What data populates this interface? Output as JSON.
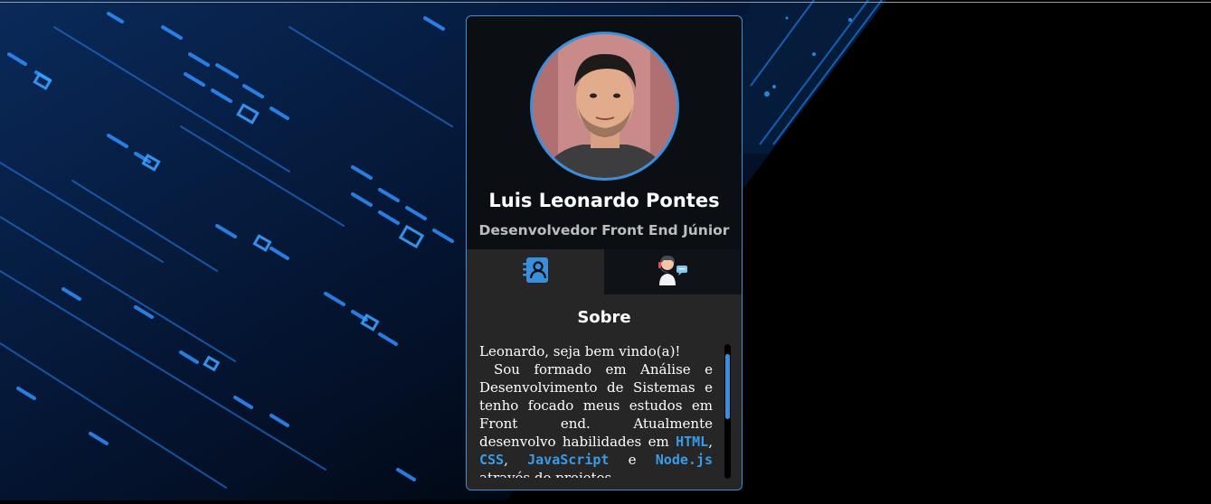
{
  "profile": {
    "name": "Luis Leonardo Pontes",
    "role": "Desenvolvedor Front End Júnior"
  },
  "tabs": [
    {
      "icon": "contact-book-icon",
      "active": true
    },
    {
      "icon": "support-agent-icon",
      "active": false
    }
  ],
  "about": {
    "title": "Sobre",
    "greeting": "Leonardo, seja bem vindo(a)!",
    "p1": "Sou formado em Análise e Desenvolvimento de Sistemas e tenho focado meus estudos em Front end. Atualmente desenvolvo habilidades em",
    "skills": [
      "HTML",
      "CSS",
      "JavaScript",
      "Node.js"
    ],
    "sep1": ", ",
    "sep2": ", ",
    "sep3": " e ",
    "p2": " através de projetos"
  },
  "colors": {
    "accent": "#3a8fdc",
    "card_bg": "#0b0f14",
    "panel_bg": "#262626"
  }
}
